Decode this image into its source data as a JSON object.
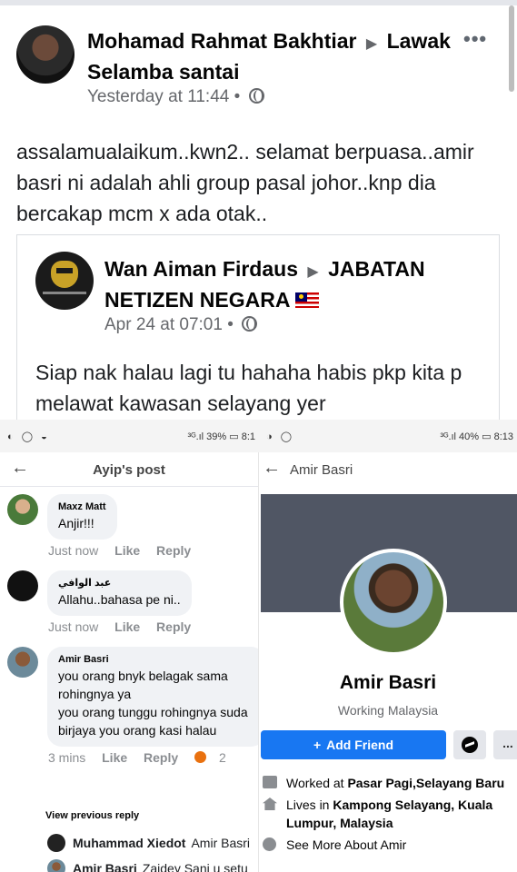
{
  "post": {
    "author": "Mohamad Rahmat Bakhtiar",
    "group": "Lawak Selamba santai",
    "timestamp": "Yesterday at 11:44",
    "dot": "•",
    "more": "•••",
    "text": "assalamualaikum..kwn2.. selamat berpuasa..amir basri ni adalah  ahli  group pasal johor..knp dia bercakap mcm x ada otak.."
  },
  "shared": {
    "author": "Wan Aiman Firdaus",
    "group": "JABATAN NETIZEN NEGARA",
    "timestamp": "Apr 24 at 07:01",
    "dot": "•",
    "text": "Siap nak halau lagi tu hahaha habis pkp kita p melawat kawasan selayang yer"
  },
  "left_screen": {
    "status_icons": "◐ ◯ ◒",
    "status_info": "³ᴳ.ıl 39% ▭ 8:1",
    "title": "Ayip's post",
    "back": "←",
    "comments": [
      {
        "name": "Maxz Matt",
        "text": "Anjir!!!",
        "time": "Just now",
        "like": "Like",
        "reply": "Reply"
      },
      {
        "name": "عبد الوافي",
        "text": "Allahu..bahasa pe ni..",
        "time": "Just now",
        "like": "Like",
        "reply": "Reply"
      },
      {
        "name": "Amir Basri",
        "text_lines": [
          "you orang bnyk belagak sama",
          "rohingnya ya",
          "you orang tunggu rohingnya suda",
          "birjaya you orang kasi halau"
        ],
        "time": "3 mins",
        "like": "Like",
        "reply": "Reply",
        "reaction_count": "2"
      }
    ],
    "view_previous": "View previous reply",
    "replies": [
      {
        "name": "Muhammad Xiedot",
        "text": "Amir Basri"
      },
      {
        "name": "Amir Basri",
        "text": "Zaidey Sani u setu"
      }
    ]
  },
  "right_screen": {
    "status_icons": "◑ ◯",
    "status_info": "³ᴳ.ıl 40% ▭ 8:13",
    "back": "←",
    "title": "Amir Basri",
    "profile_name": "Amir Basri",
    "profile_work": "Working Malaysia",
    "add_friend": "Add Friend",
    "more": "...",
    "info": {
      "worked_prefix": "Worked at ",
      "worked_place": "Pasar Pagi,Selayang Baru",
      "lives_prefix": "Lives in ",
      "lives_place": "Kampong Selayang, Kuala Lumpur, Malaysia",
      "see_more": "See More About Amir"
    }
  },
  "colors": {
    "facebook_blue": "#1877f2",
    "secondary_text": "#65676b",
    "bubble_bg": "#f0f2f5",
    "cover": "#505664"
  }
}
